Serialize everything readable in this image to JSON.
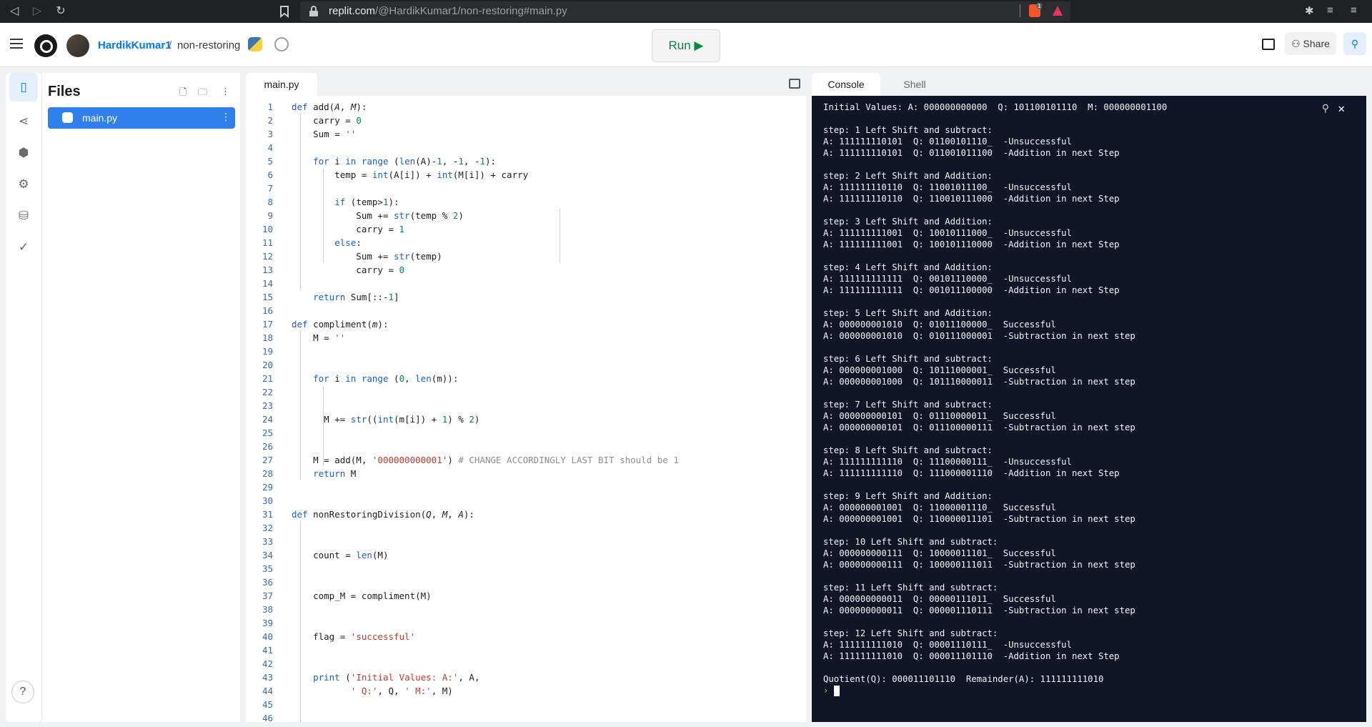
{
  "browser": {
    "url_host": "replit.com",
    "url_path": "/@HardikKumar1/non-restoring#main.py",
    "brave_badge": "1"
  },
  "header": {
    "username": "HardikKumar1",
    "separator": "/",
    "repl_name": "non-restoring",
    "run_label": "Run ▶",
    "share_label": "Share"
  },
  "files": {
    "title": "Files",
    "items": [
      {
        "name": "main.py"
      }
    ]
  },
  "editor": {
    "tab": "main.py",
    "lines": [
      {
        "n": "1",
        "html": "<span class='kw'>def</span> add(<i>A</i>, <i>M</i>):"
      },
      {
        "n": "2",
        "html": "    carry = <span class='num'>0</span>"
      },
      {
        "n": "3",
        "html": "    Sum = <span class='str'>''</span>"
      },
      {
        "n": "4",
        "html": ""
      },
      {
        "n": "5",
        "html": "    <span class='kw'>for</span> i <span class='kw'>in</span> <span class='kw'>range</span> (<span class='kw'>len</span>(A)-<span class='num'>1</span>, -<span class='num'>1</span>, -<span class='num'>1</span>):"
      },
      {
        "n": "6",
        "html": "        temp = <span class='kw'>int</span>(A[i]) + <span class='kw'>int</span>(M[i]) + carry"
      },
      {
        "n": "7",
        "html": ""
      },
      {
        "n": "8",
        "html": "        <span class='kw'>if</span> (temp&gt;<span class='num'>1</span>):"
      },
      {
        "n": "9",
        "html": "            Sum += <span class='kw'>str</span>(temp % <span class='num'>2</span>)"
      },
      {
        "n": "10",
        "html": "            carry = <span class='num'>1</span>"
      },
      {
        "n": "11",
        "html": "        <span class='kw'>else</span>:"
      },
      {
        "n": "12",
        "html": "            Sum += <span class='kw'>str</span>(temp)"
      },
      {
        "n": "13",
        "html": "            carry = <span class='num'>0</span>"
      },
      {
        "n": "14",
        "html": ""
      },
      {
        "n": "15",
        "html": "    <span class='kw'>return</span> Sum[::-<span class='num'>1</span>]"
      },
      {
        "n": "16",
        "html": ""
      },
      {
        "n": "17",
        "html": "<span class='kw'>def</span> compliment(<i>m</i>):"
      },
      {
        "n": "18",
        "html": "    M = <span class='str'>''</span>"
      },
      {
        "n": "19",
        "html": ""
      },
      {
        "n": "20",
        "html": ""
      },
      {
        "n": "21",
        "html": "    <span class='kw'>for</span> i <span class='kw'>in</span> <span class='kw'>range</span> (<span class='num'>0</span>, <span class='kw'>len</span>(m)):"
      },
      {
        "n": "22",
        "html": ""
      },
      {
        "n": "23",
        "html": ""
      },
      {
        "n": "24",
        "html": "      M += <span class='kw'>str</span>((<span class='kw'>int</span>(m[i]) + <span class='num'>1</span>) % <span class='num'>2</span>)"
      },
      {
        "n": "25",
        "html": ""
      },
      {
        "n": "26",
        "html": ""
      },
      {
        "n": "27",
        "html": "    M = add(M, <span class='str'>'000000000001'</span>) <span class='cm'># CHANGE ACCORDINGLY LAST BIT should be 1</span>"
      },
      {
        "n": "28",
        "html": "    <span class='kw'>return</span> M"
      },
      {
        "n": "29",
        "html": ""
      },
      {
        "n": "30",
        "html": ""
      },
      {
        "n": "31",
        "html": "<span class='kw'>def</span> nonRestoringDivision(<i>Q</i>, <i>M</i>, <i>A</i>):"
      },
      {
        "n": "32",
        "html": ""
      },
      {
        "n": "33",
        "html": ""
      },
      {
        "n": "34",
        "html": "    count = <span class='kw'>len</span>(M)"
      },
      {
        "n": "35",
        "html": ""
      },
      {
        "n": "36",
        "html": ""
      },
      {
        "n": "37",
        "html": "    comp_M = compliment(M)"
      },
      {
        "n": "38",
        "html": ""
      },
      {
        "n": "39",
        "html": ""
      },
      {
        "n": "40",
        "html": "    flag = <span class='str'>'successful'</span>"
      },
      {
        "n": "41",
        "html": ""
      },
      {
        "n": "42",
        "html": ""
      },
      {
        "n": "43",
        "html": "    <span class='kw'>print</span> (<span class='str'>'Initial Values: A:'</span>, A,"
      },
      {
        "n": "44",
        "html": "           <span class='str'>' Q:'</span>, Q, <span class='str'>' M:'</span>, M)"
      },
      {
        "n": "45",
        "html": ""
      },
      {
        "n": "46",
        "html": ""
      }
    ]
  },
  "console": {
    "tabs": [
      "Console",
      "Shell"
    ],
    "lines": [
      "Initial Values: A: 000000000000  Q: 101100101110  M: 000000001100",
      "",
      "step: 1 Left Shift and subtract:",
      "A: 111111110101  Q: 01100101110_  -Unsuccessful",
      "A: 111111110101  Q: 011001011100  -Addition in next Step",
      "",
      "step: 2 Left Shift and Addition:",
      "A: 111111110110  Q: 11001011100_  -Unsuccessful",
      "A: 111111110110  Q: 110010111000  -Addition in next Step",
      "",
      "step: 3 Left Shift and Addition:",
      "A: 111111111001  Q: 10010111000_  -Unsuccessful",
      "A: 111111111001  Q: 100101110000  -Addition in next Step",
      "",
      "step: 4 Left Shift and Addition:",
      "A: 111111111111  Q: 00101110000_  -Unsuccessful",
      "A: 111111111111  Q: 001011100000  -Addition in next Step",
      "",
      "step: 5 Left Shift and Addition:",
      "A: 000000001010  Q: 01011100000_  Successful",
      "A: 000000001010  Q: 010111000001  -Subtraction in next step",
      "",
      "step: 6 Left Shift and subtract:",
      "A: 000000001000  Q: 10111000001_  Successful",
      "A: 000000001000  Q: 101110000011  -Subtraction in next step",
      "",
      "step: 7 Left Shift and subtract:",
      "A: 000000000101  Q: 01110000011_  Successful",
      "A: 000000000101  Q: 011100000111  -Subtraction in next step",
      "",
      "step: 8 Left Shift and subtract:",
      "A: 111111111110  Q: 11100000111_  -Unsuccessful",
      "A: 111111111110  Q: 111000001110  -Addition in next Step",
      "",
      "step: 9 Left Shift and Addition:",
      "A: 000000001001  Q: 11000001110_  Successful",
      "A: 000000001001  Q: 110000011101  -Subtraction in next step",
      "",
      "step: 10 Left Shift and subtract:",
      "A: 000000000111  Q: 10000011101_  Successful",
      "A: 000000000111  Q: 100000111011  -Subtraction in next step",
      "",
      "step: 11 Left Shift and subtract:",
      "A: 000000000011  Q: 00000111011_  Successful",
      "A: 000000000011  Q: 000001110111  -Subtraction in next step",
      "",
      "step: 12 Left Shift and subtract:",
      "A: 111111111010  Q: 00001110111_  -Unsuccessful",
      "A: 111111111010  Q: 000011101110  -Addition in next Step",
      "",
      "Quotient(Q): 000011101110  Remainder(A): 111111111010"
    ],
    "prompt": "›"
  }
}
